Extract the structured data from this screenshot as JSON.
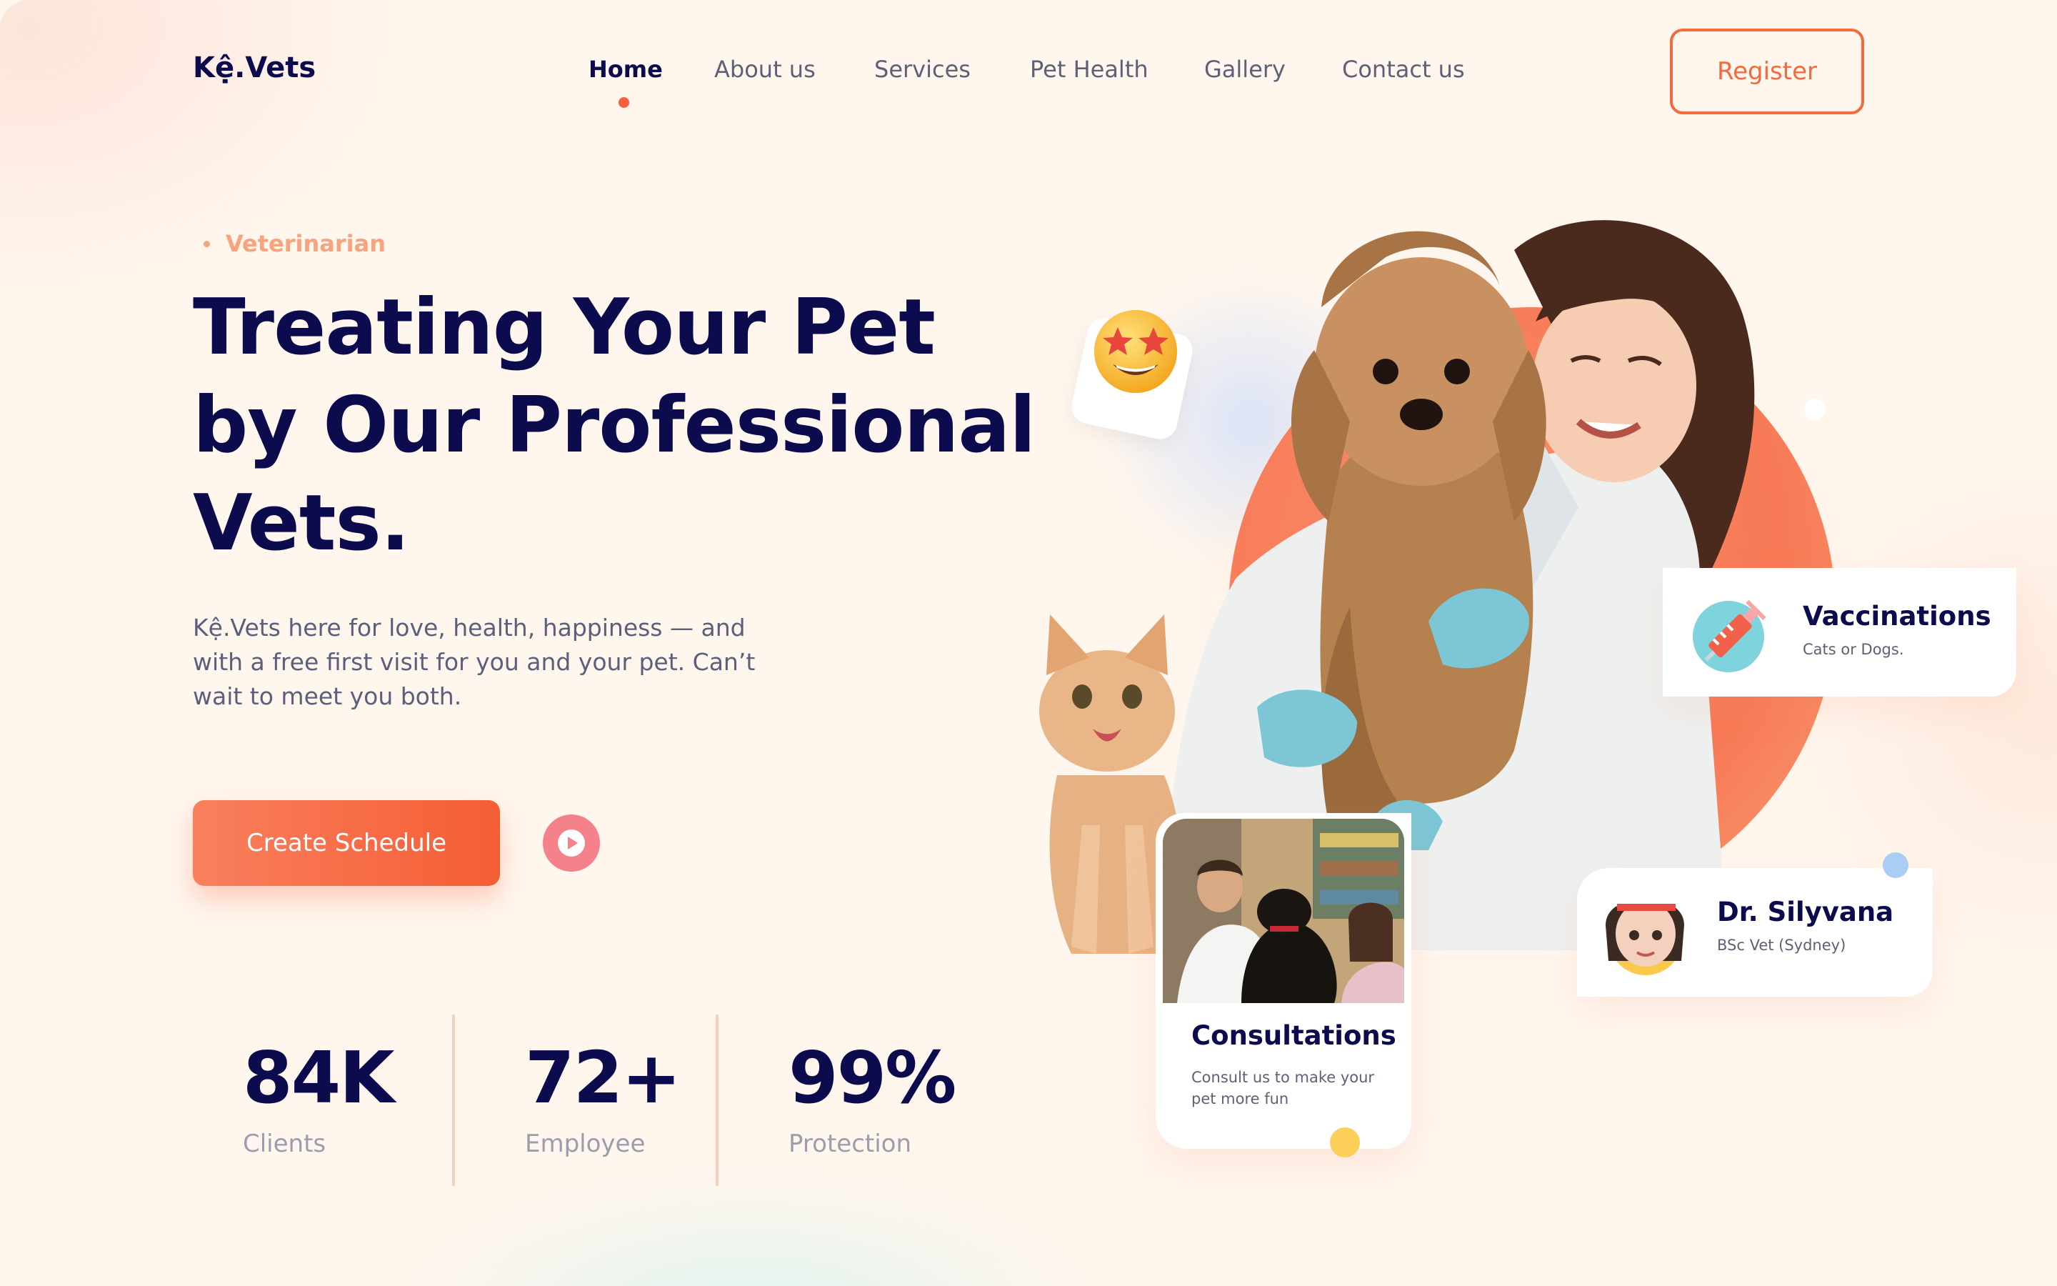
{
  "brand": {
    "logo": "Kệ.Vets"
  },
  "nav": {
    "items": [
      "Home",
      "About us",
      "Services",
      "Pet Health",
      "Gallery",
      "Contact us"
    ],
    "active": "Home",
    "register_label": "Register"
  },
  "hero": {
    "eyebrow": "Veterinarian",
    "headline_lines": [
      "Treating Your Pet",
      "by Our Professional",
      "Vets."
    ],
    "description": "Kệ.Vets here for love, health, happiness — and with a free first visit for you and your pet. Can’t wait to meet you both.",
    "cta_label": "Create Schedule"
  },
  "stats": [
    {
      "value": "84K",
      "label": "Clients"
    },
    {
      "value": "72+",
      "label": "Employee"
    },
    {
      "value": "99%",
      "label": "Protection"
    }
  ],
  "cards": {
    "vaccinations": {
      "title": "Vaccinations",
      "subtitle": "Cats or Dogs."
    },
    "doctor": {
      "name": "Dr. Silyvana",
      "credential": "BSc Vet (Sydney)"
    },
    "consultations": {
      "title": "Consultations",
      "description": "Consult us to make your pet more fun"
    }
  },
  "icons": {
    "play": "play-icon",
    "emoji": "star-struck-emoji-icon",
    "syringe": "syringe-icon"
  },
  "colors": {
    "primary_navy": "#0c0b4d",
    "accent_orange": "#f26a3d",
    "eyebrow_peach": "#f7a37d",
    "play_pink": "#f5818a"
  }
}
